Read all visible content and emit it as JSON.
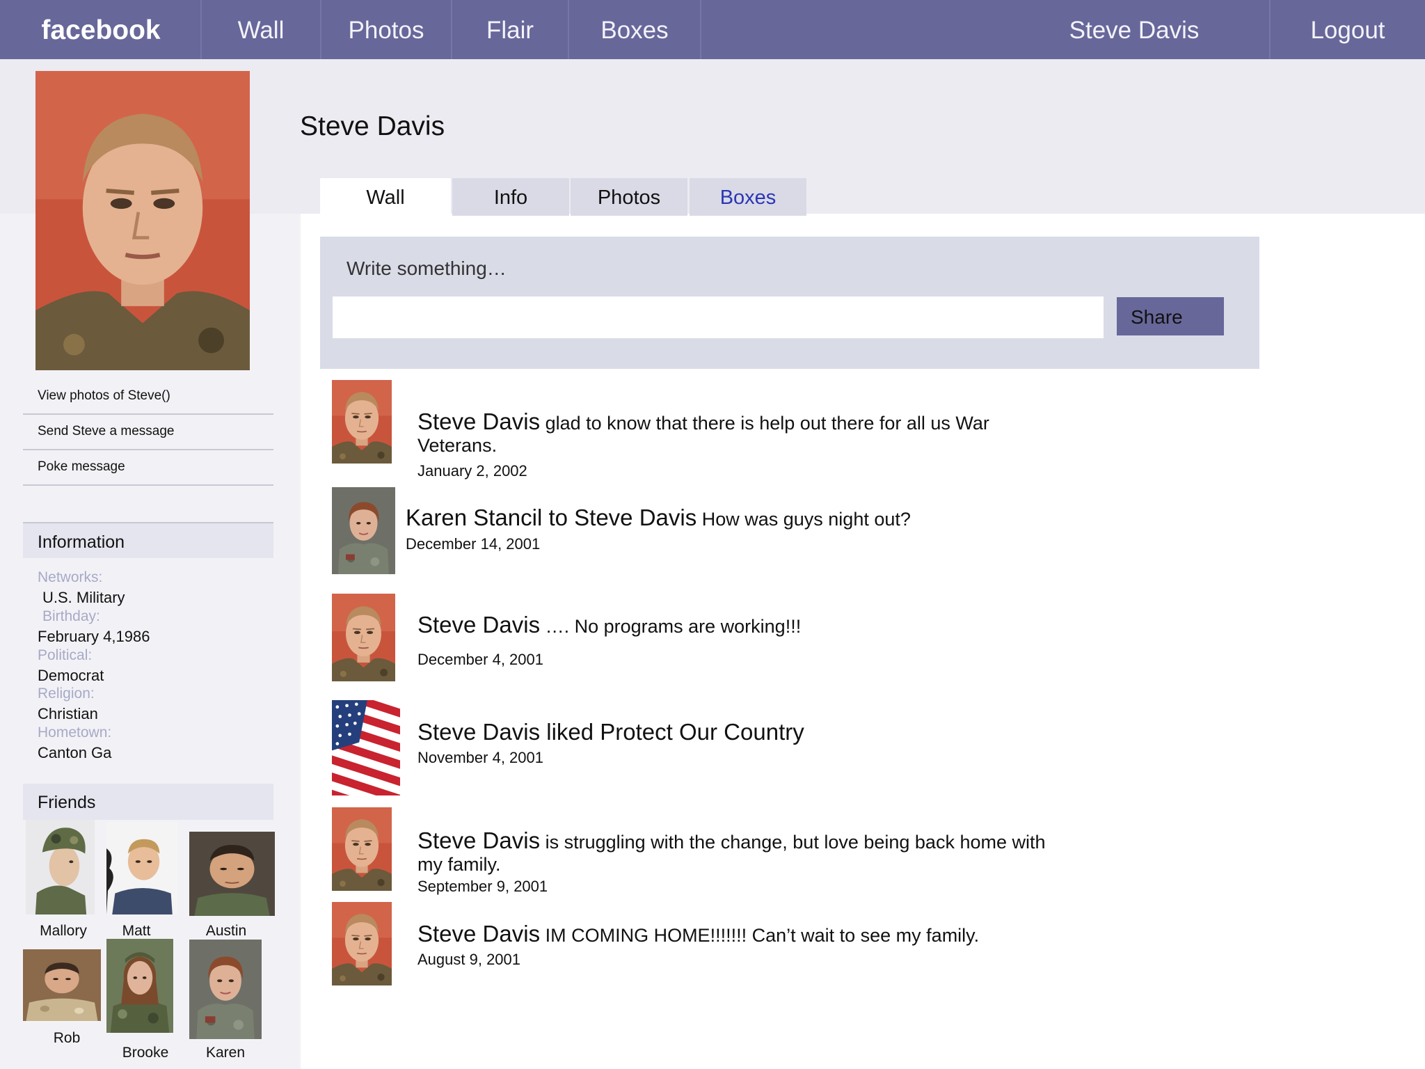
{
  "topbar": {
    "logo": "facebook",
    "nav": [
      "Wall",
      "Photos",
      "Flair",
      "Boxes"
    ],
    "user": "Steve Davis",
    "logout": "Logout"
  },
  "profile": {
    "name": "Steve Davis",
    "tabs": [
      "Wall",
      "Info",
      "Photos",
      "Boxes"
    ],
    "links": [
      "View photos of Steve()",
      "Send Steve a message",
      "Poke message"
    ]
  },
  "information": {
    "heading": "Information",
    "networks_label": "Networks:",
    "networks": "U.S. Military",
    "birthday_label": "Birthday:",
    "birthday": "February 4,1986",
    "political_label": "Political:",
    "political": "Democrat",
    "religion_label": "Religion:",
    "religion": "Christian",
    "hometown_label": "Hometown:",
    "hometown": "Canton Ga"
  },
  "friends": {
    "heading": "Friends",
    "names": [
      "Mallory",
      "Matt",
      "Austin",
      "Rob",
      "Brooke",
      "Karen"
    ]
  },
  "composer": {
    "label": "Write something…",
    "share": "Share"
  },
  "posts": [
    {
      "who": "Steve Davis",
      "text": " glad to know that there is help out there for all us War",
      "text2": "Veterans.",
      "date": "January 2, 2002"
    },
    {
      "who": "Karen Stancil to Steve Davis",
      "text": " How was guys night out?",
      "date": "December 14, 2001"
    },
    {
      "who": "Steve Davis",
      "text": " …. No programs are working!!!",
      "date": "December 4, 2001"
    },
    {
      "who": "Steve Davis",
      "text": " liked Protect Our Country",
      "date": "November 4, 2001"
    },
    {
      "who": "Steve Davis",
      "text": " is struggling with the change, but love being back home with",
      "text2": "my family.",
      "date": "September 9, 2001"
    },
    {
      "who": "Steve Davis",
      "text": " IM COMING HOME!!!!!!! Can’t wait to see my family.",
      "date": "August 9, 2001"
    }
  ]
}
